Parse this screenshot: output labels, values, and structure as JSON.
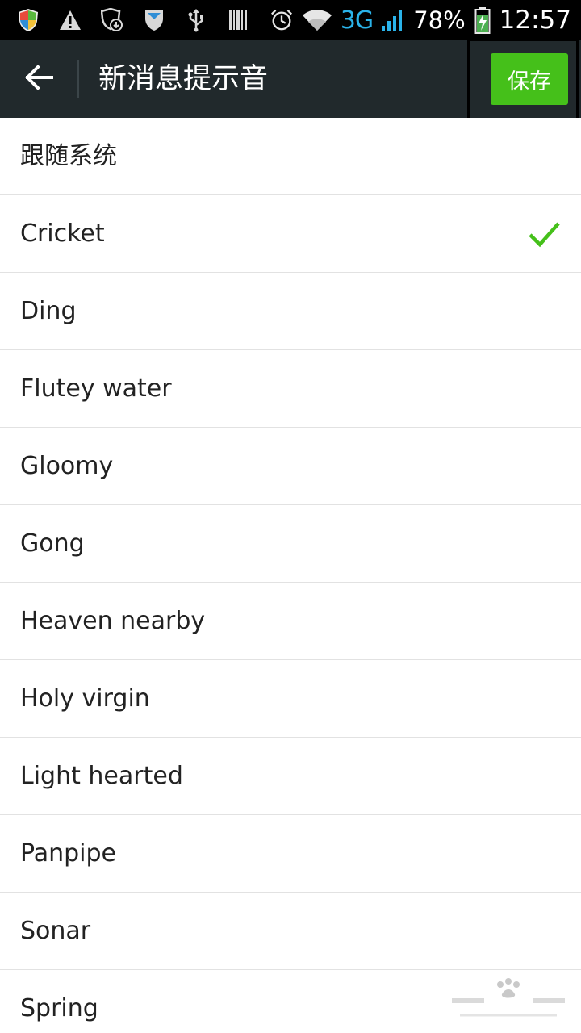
{
  "status_bar": {
    "network_type": "3G",
    "battery_percent": "78%",
    "time": "12:57",
    "icons_left": [
      "shield-color-icon",
      "warning-icon",
      "download-shield-icon",
      "vpn-shield-icon",
      "usb-icon",
      "barcode-icon"
    ],
    "icons_right": [
      "alarm-icon",
      "wifi-icon",
      "signal-icon",
      "battery-charging-icon"
    ],
    "accent_color": "#2ab3ea"
  },
  "header": {
    "title": "新消息提示音",
    "save_label": "保存",
    "save_color": "#45c01a",
    "background": "#21292c"
  },
  "sounds": {
    "selected": "Cricket",
    "items": [
      {
        "label": "跟随系统",
        "selected": false
      },
      {
        "label": "Cricket",
        "selected": true
      },
      {
        "label": "Ding",
        "selected": false
      },
      {
        "label": "Flutey water",
        "selected": false
      },
      {
        "label": "Gloomy",
        "selected": false
      },
      {
        "label": "Gong",
        "selected": false
      },
      {
        "label": "Heaven nearby",
        "selected": false
      },
      {
        "label": "Holy virgin",
        "selected": false
      },
      {
        "label": "Light hearted",
        "selected": false
      },
      {
        "label": "Panpipe",
        "selected": false
      },
      {
        "label": "Sonar",
        "selected": false
      },
      {
        "label": "Spring",
        "selected": false
      }
    ],
    "check_color": "#45c01a"
  }
}
